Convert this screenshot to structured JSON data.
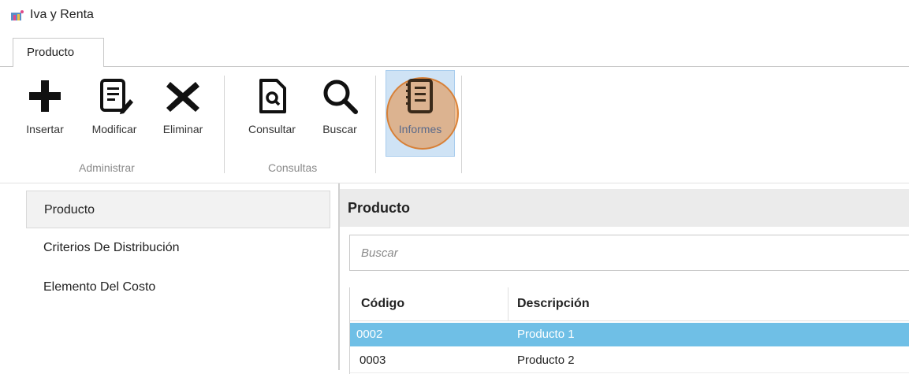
{
  "window": {
    "title": "Iva y Renta"
  },
  "tabs": [
    {
      "label": "Producto"
    }
  ],
  "ribbon": {
    "groups": [
      {
        "label": "Administrar"
      },
      {
        "label": "Consultas"
      }
    ],
    "buttons": [
      {
        "label": "Insertar",
        "icon": "plus-icon"
      },
      {
        "label": "Modificar",
        "icon": "edit-document-icon"
      },
      {
        "label": "Eliminar",
        "icon": "close-icon"
      },
      {
        "label": "Consultar",
        "icon": "search-document-icon"
      },
      {
        "label": "Buscar",
        "icon": "search-icon"
      },
      {
        "label": "Informes",
        "icon": "report-icon"
      }
    ]
  },
  "sidebar": {
    "items": [
      {
        "label": "Producto"
      },
      {
        "label": "Criterios De Distribución"
      },
      {
        "label": "Elemento Del Costo"
      }
    ]
  },
  "main": {
    "title": "Producto",
    "search": {
      "placeholder": "Buscar",
      "value": ""
    },
    "table": {
      "columns": [
        "Código",
        "Descripción"
      ],
      "rows": [
        {
          "codigo": "0002",
          "descripcion": "Producto 1"
        },
        {
          "codigo": "0003",
          "descripcion": "Producto 2"
        }
      ]
    }
  },
  "colors": {
    "selection": "#6fbfe6",
    "informes_highlight": "#cfe3f5",
    "cursor_circle": "#e78c3c"
  }
}
